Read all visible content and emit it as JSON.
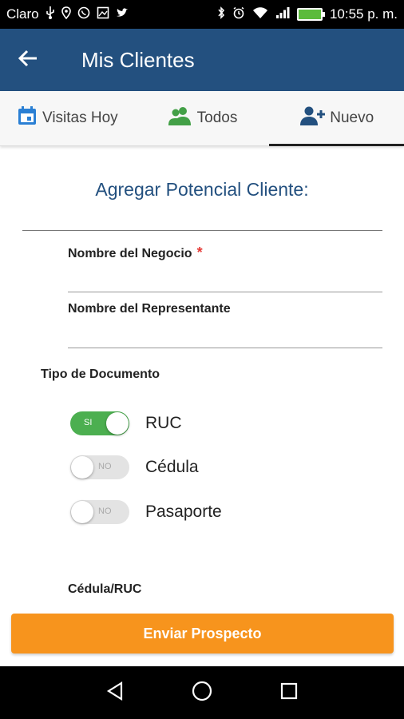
{
  "status_bar": {
    "carrier": "Claro",
    "time": "10:55 p. m.",
    "icons": [
      "usb-icon",
      "location-icon",
      "whatsapp-icon",
      "image-icon",
      "twitter-icon",
      "bluetooth-icon",
      "alarm-icon",
      "wifi-icon",
      "signal-icon",
      "battery-icon"
    ]
  },
  "app_bar": {
    "title": "Mis Clientes"
  },
  "tabs": [
    {
      "label": "Visitas Hoy",
      "icon": "calendar-icon",
      "icon_color": "#2a7fd4"
    },
    {
      "label": "Todos",
      "icon": "users-icon",
      "icon_color": "#43a047"
    },
    {
      "label": "Nuevo",
      "icon": "add-user-icon",
      "icon_color": "#23507f",
      "active": true
    }
  ],
  "form": {
    "title": "Agregar Potencial Cliente:",
    "business_name_label": "Nombre del Negocio",
    "required_mark": "*",
    "representative_label": "Nombre del Representante",
    "doc_type_label": "Tipo de Documento",
    "doc_options": [
      {
        "label": "RUC",
        "state": "SI",
        "on": true
      },
      {
        "label": "Cédula",
        "state": "NO",
        "on": false
      },
      {
        "label": "Pasaporte",
        "state": "NO",
        "on": false
      }
    ],
    "id_label": "Cédula/RUC"
  },
  "submit": {
    "label": "Enviar Prospecto"
  },
  "colors": {
    "primary": "#23507f",
    "accent": "#f7941d",
    "toggle_on": "#4caf50",
    "required": "#e53935"
  }
}
